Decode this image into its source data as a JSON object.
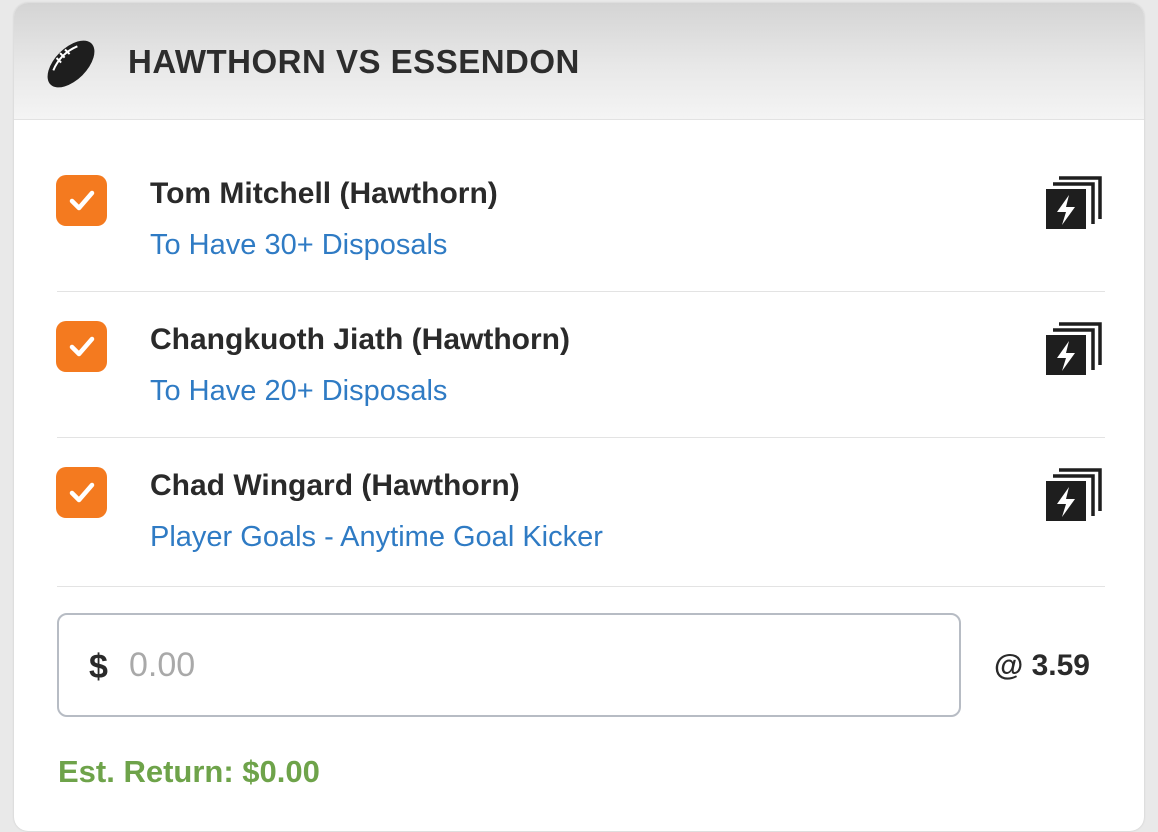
{
  "header": {
    "icon": "football-icon",
    "title": "HAWTHORN VS ESSENDON"
  },
  "legs": [
    {
      "checked": true,
      "name": "Tom Mitchell (Hawthorn)",
      "market": "To Have 30+ Disposals",
      "icon": "same-game-multi-icon"
    },
    {
      "checked": true,
      "name": "Changkuoth Jiath (Hawthorn)",
      "market": "To Have 20+ Disposals",
      "icon": "same-game-multi-icon"
    },
    {
      "checked": true,
      "name": "Chad Wingard (Hawthorn)",
      "market": "Player Goals - Anytime Goal Kicker",
      "icon": "same-game-multi-icon"
    }
  ],
  "stake": {
    "currency": "$",
    "placeholder": "0.00",
    "value": ""
  },
  "odds": "@ 3.59",
  "est_return": "Est. Return: $0.00",
  "colors": {
    "accent_orange": "#f47a1f",
    "market_blue": "#2f7bc4",
    "return_green": "#6ea34a",
    "text_dark": "#2a2a2a"
  }
}
